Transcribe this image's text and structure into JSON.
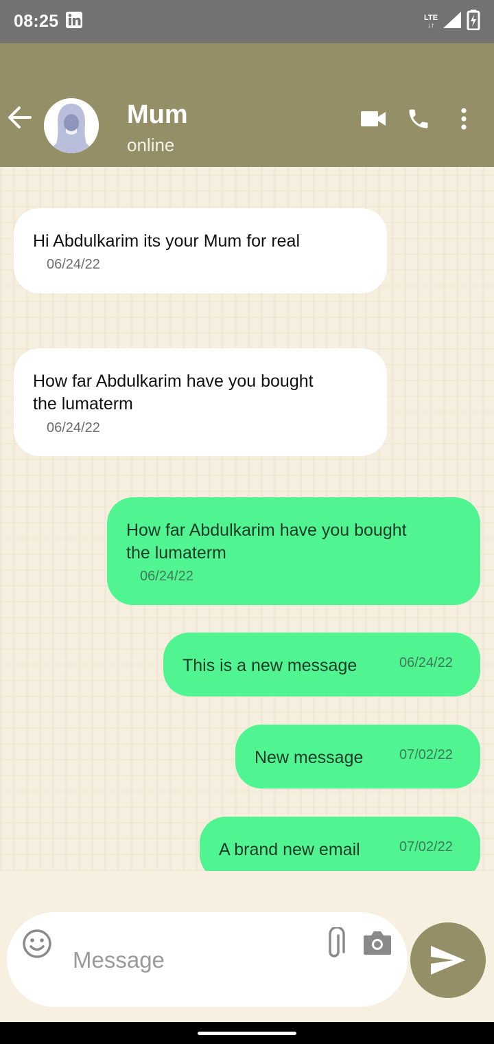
{
  "status_bar": {
    "time": "08:25",
    "network": "LTE"
  },
  "header": {
    "contact_name": "Mum",
    "contact_status": "online"
  },
  "messages": [
    {
      "direction": "in",
      "text": "Hi Abdulkarim its your Mum for real",
      "date": "06/24/22"
    },
    {
      "direction": "in",
      "text": "How far Abdulkarim have you bought\nthe lumaterm",
      "date": "06/24/22"
    },
    {
      "direction": "out",
      "text": "How far Abdulkarim have you bought\nthe lumaterm",
      "date": "06/24/22"
    },
    {
      "direction": "out",
      "text": "This is a new message",
      "date": "06/24/22"
    },
    {
      "direction": "out",
      "text": "New message",
      "date": "07/02/22"
    },
    {
      "direction": "out",
      "text": "A brand new email",
      "date": "07/02/22"
    }
  ],
  "composer": {
    "placeholder": "Message",
    "value": ""
  },
  "colors": {
    "app_bar": "#958f68",
    "outgoing_bubble": "#50f592",
    "incoming_bubble": "#ffffff"
  }
}
